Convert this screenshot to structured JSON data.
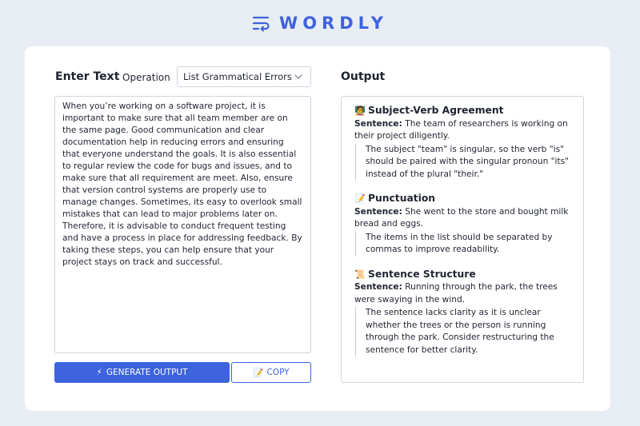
{
  "brand": {
    "name": "WORDLY",
    "icon": "wrap-text-icon",
    "color": "#3d63dd"
  },
  "input_panel": {
    "label": "Enter Text",
    "operation_label": "Operation",
    "operation_selected": "List Grammatical Errors",
    "text": "When you’re working on a software project, it is important to make sure that all team member are on the same page. Good communication and clear documentation help in reducing errors and ensuring that everyone understand the goals. It is also essential to regular review the code for bugs and issues, and to make sure that all requirement are meet. Also, ensure that version control systems are properly use to manage changes. Sometimes, its easy to overlook small mistakes that can lead to major problems later on. Therefore, it is advisable to conduct frequent testing and have a process in place for addressing feedback. By taking these steps, you can help ensure that your project stays on track and successful.",
    "generate_label": "GENERATE OUTPUT",
    "generate_icon": "⚡",
    "copy_label": "COPY",
    "copy_icon": "📝"
  },
  "output_panel": {
    "label": "Output",
    "sentence_prefix": "Sentence:",
    "sections": [
      {
        "icon": "🧑‍🏫",
        "title": "Subject-Verb Agreement",
        "sentence": "The team of researchers is working on their project diligently.",
        "explanation": "The subject \"team\" is singular, so the verb \"is\" should be paired with the singular pronoun \"its\" instead of the plural \"their.\""
      },
      {
        "icon": "📝",
        "title": "Punctuation",
        "sentence": "She went to the store and bought milk bread and eggs.",
        "explanation": "The items in the list should be separated by commas to improve readability."
      },
      {
        "icon": "📜",
        "title": "Sentence Structure",
        "sentence": "Running through the park, the trees were swaying in the wind.",
        "explanation": "The sentence lacks clarity as it is unclear whether the trees or the person is running through the park. Consider restructuring the sentence for better clarity."
      }
    ]
  },
  "colors": {
    "background": "#e8ecf3",
    "accent": "#3d63dd",
    "card": "#ffffff"
  }
}
